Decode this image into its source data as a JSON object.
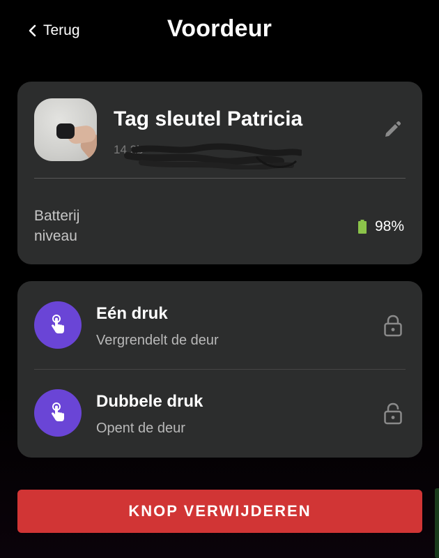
{
  "header": {
    "back_label": "Terug",
    "title": "Voordeur"
  },
  "tag": {
    "name": "Tag sleutel Patricia",
    "subtitle": "14 2b",
    "battery_label": "Batterij niveau",
    "battery_value": "98%",
    "battery_level": 0.98,
    "battery_color": "#8bc34a"
  },
  "actions": [
    {
      "title": "Eén druk",
      "description": "Vergrendelt de deur",
      "icon": "hand-press-icon",
      "status_icon": "lock-closed-icon"
    },
    {
      "title": "Dubbele druk",
      "description": "Opent de deur",
      "icon": "hand-press-icon",
      "status_icon": "lock-open-icon"
    }
  ],
  "delete_button": "KNOP VERWIJDEREN",
  "colors": {
    "background": "#000000",
    "card": "#2c2d2d",
    "accent_purple": "#6a45d6",
    "danger": "#d13535"
  }
}
